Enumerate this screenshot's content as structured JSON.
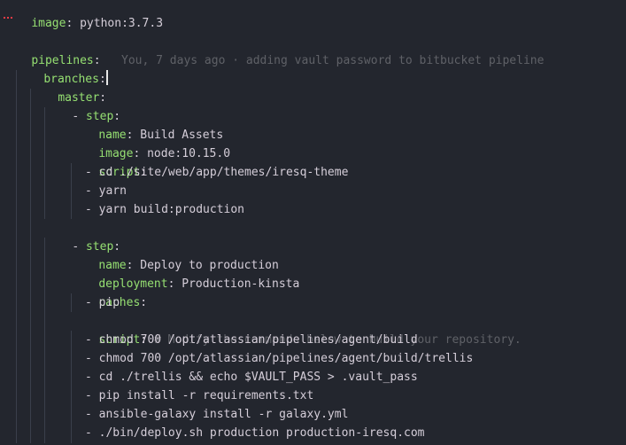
{
  "colors": {
    "background": "#23262e",
    "key": "#96e072",
    "value": "#d5ced9",
    "comment": "#5f6167",
    "error": "#e83a45"
  },
  "lines": {
    "l0": {
      "key": "image",
      "value": "python:3.7.3"
    },
    "l2": {
      "key": "pipelines"
    },
    "l3": {
      "key": "branches"
    },
    "blame": "You, 7 days ago · adding vault password to bitbucket pipeline",
    "l4": {
      "key": "master"
    },
    "l5": {
      "dash": "-",
      "key": "step"
    },
    "l6": {
      "key": "name",
      "value": "Build Assets"
    },
    "l7": {
      "key": "image",
      "value": "node:10.15.0"
    },
    "l8": {
      "key": "script"
    },
    "l9": {
      "text": "- cd ./site/web/app/themes/iresq-theme"
    },
    "l10": {
      "text": "- yarn"
    },
    "l11": {
      "text": "- yarn build:production"
    },
    "l12": {
      "dash": "-",
      "key": "step"
    },
    "l13": {
      "key": "name",
      "value": "Deploy to production"
    },
    "l14": {
      "key": "deployment",
      "value": "Production-kinsta"
    },
    "l15": {
      "key": "caches"
    },
    "l16": {
      "text": "- pip"
    },
    "l17": {
      "key": "script",
      "comment": "# Modify the commands below to build your repository."
    },
    "l18": {
      "text": "- chmod 700 /opt/atlassian/pipelines/agent/build"
    },
    "l19": {
      "text": "- chmod 700 /opt/atlassian/pipelines/agent/build/trellis"
    },
    "l20": {
      "text": "- cd ./trellis && echo $VAULT_PASS > .vault_pass"
    },
    "l21": {
      "text": "- pip install -r requirements.txt"
    },
    "l22": {
      "text": "- ansible-galaxy install -r galaxy.yml"
    },
    "l23": {
      "text": "- ./bin/deploy.sh production production-iresq.com"
    }
  }
}
